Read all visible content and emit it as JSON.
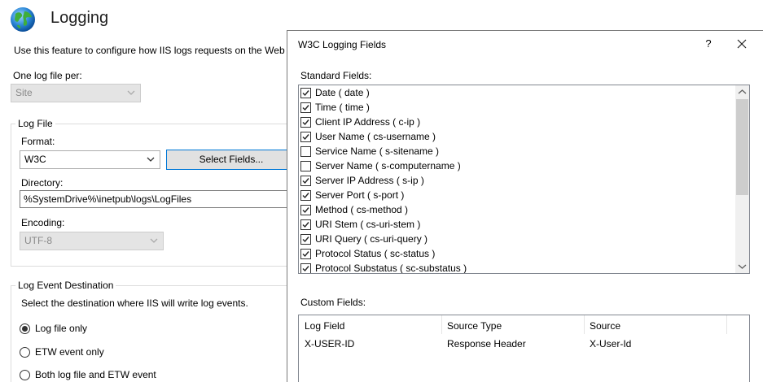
{
  "page": {
    "title": "Logging",
    "description": "Use this feature to configure how IIS logs requests on the Web s",
    "log_file_per_label": "One log file per:",
    "log_file_per_value": "Site"
  },
  "log_file": {
    "group_title": "Log File",
    "format_label": "Format:",
    "format_value": "W3C",
    "select_fields_label": "Select Fields...",
    "directory_label": "Directory:",
    "directory_value": "%SystemDrive%\\inetpub\\logs\\LogFiles",
    "encoding_label": "Encoding:",
    "encoding_value": "UTF-8"
  },
  "event_destination": {
    "group_title": "Log Event Destination",
    "description": "Select the destination where IIS will write log events.",
    "options": [
      {
        "label": "Log file only",
        "selected": true
      },
      {
        "label": "ETW event only",
        "selected": false
      },
      {
        "label": "Both log file and ETW event",
        "selected": false
      }
    ]
  },
  "dialog": {
    "title": "W3C Logging Fields",
    "help_glyph": "?",
    "standard_label": "Standard Fields:",
    "standard_fields": [
      {
        "label": "Date ( date )",
        "checked": true
      },
      {
        "label": "Time ( time )",
        "checked": true
      },
      {
        "label": "Client IP Address ( c-ip )",
        "checked": true
      },
      {
        "label": "User Name ( cs-username )",
        "checked": true
      },
      {
        "label": "Service Name ( s-sitename )",
        "checked": false
      },
      {
        "label": "Server Name ( s-computername )",
        "checked": false
      },
      {
        "label": "Server IP Address ( s-ip )",
        "checked": true
      },
      {
        "label": "Server Port ( s-port )",
        "checked": true
      },
      {
        "label": "Method ( cs-method )",
        "checked": true
      },
      {
        "label": "URI Stem ( cs-uri-stem )",
        "checked": true
      },
      {
        "label": "URI Query ( cs-uri-query )",
        "checked": true
      },
      {
        "label": "Protocol Status ( sc-status )",
        "checked": true
      },
      {
        "label": "Protocol Substatus ( sc-substatus )",
        "checked": true
      }
    ],
    "custom_label": "Custom Fields:",
    "custom_columns": [
      "Log Field",
      "Source Type",
      "Source"
    ],
    "custom_rows": [
      [
        "X-USER-ID",
        "Response Header",
        "X-User-Id"
      ]
    ]
  },
  "icons": {
    "globe": "globe-icon",
    "dropdown": "chevron-down-icon",
    "close": "close-icon",
    "check": "checkmark-icon",
    "scroll_up": "scroll-up-icon",
    "scroll_down": "scroll-down-icon"
  },
  "colors": {
    "accent_border": "#0078d7",
    "disabled_bg": "#e4e4e4",
    "disabled_text": "#8a8a8a"
  }
}
